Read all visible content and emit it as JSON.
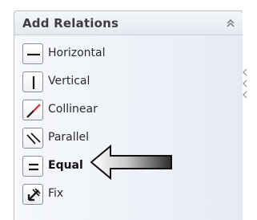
{
  "panel": {
    "title": "Add Relations",
    "collapse_icon": "double-chevron-up-icon"
  },
  "relations": [
    {
      "label": "Horizontal",
      "icon": "horizontal-line-icon",
      "bold": false
    },
    {
      "label": "Vertical",
      "icon": "vertical-line-icon",
      "bold": false
    },
    {
      "label": "Collinear",
      "icon": "collinear-icon",
      "bold": false
    },
    {
      "label": "Parallel",
      "icon": "parallel-icon",
      "bold": false
    },
    {
      "label": "Equal",
      "icon": "equal-icon",
      "bold": true
    },
    {
      "label": "Fix",
      "icon": "fix-anchor-icon",
      "bold": false
    }
  ],
  "annotation": {
    "icon": "pointer-arrow-icon"
  },
  "colors": {
    "accent_red": "#d8262d",
    "icon_stroke": "#1a1a1a",
    "panel_border": "#b9c3d2"
  }
}
